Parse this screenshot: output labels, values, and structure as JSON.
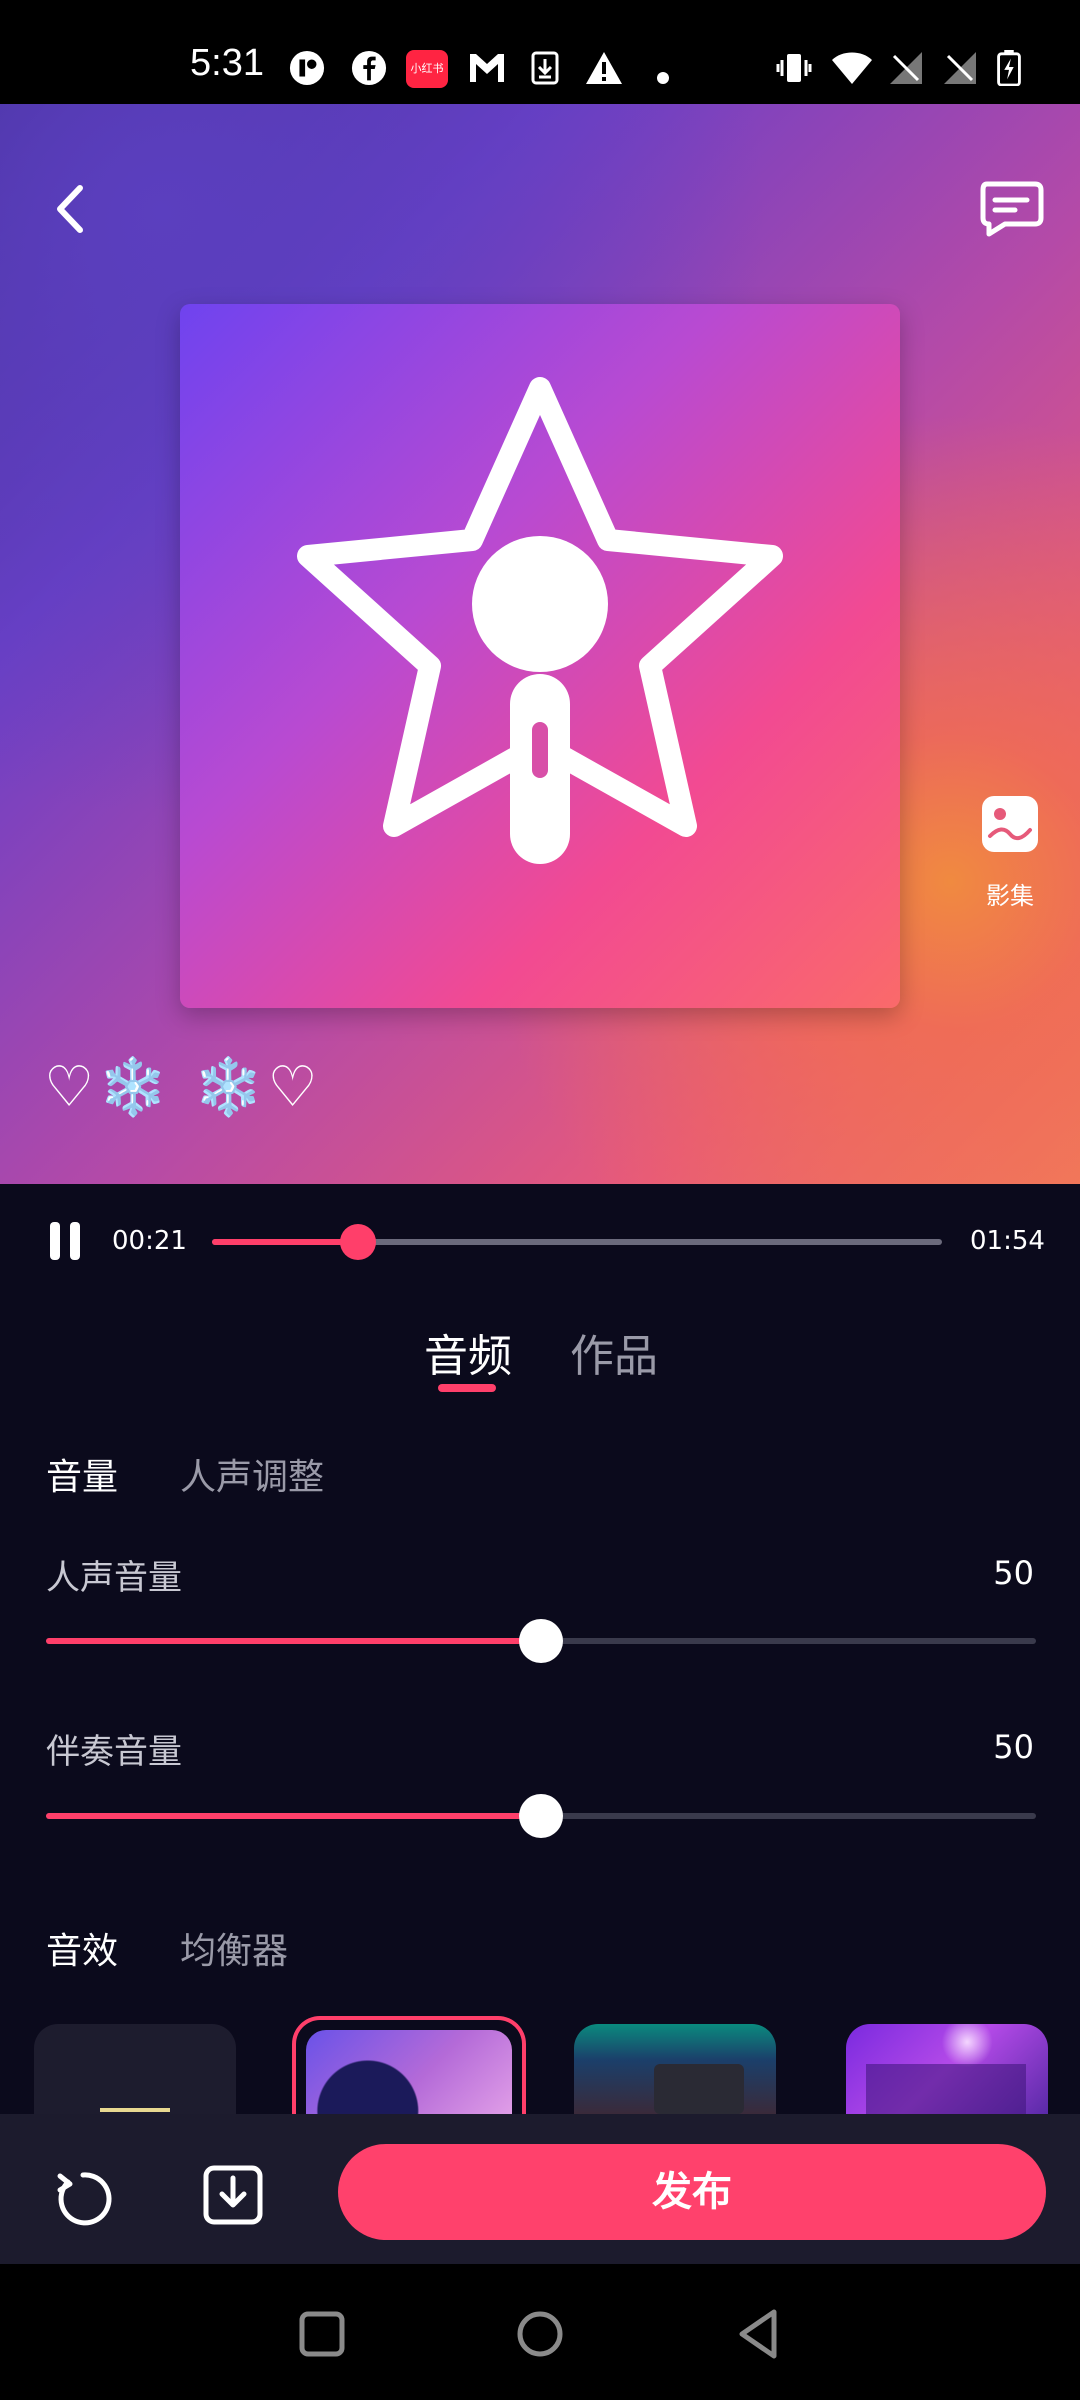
{
  "status_bar": {
    "time": "5:31",
    "icons": [
      "app-icon",
      "facebook-icon",
      "xiaohongshu-icon",
      "gmail-icon",
      "download-icon",
      "alert-icon",
      "dot-icon",
      "vibrate-icon",
      "wifi-icon",
      "no-signal-icon",
      "no-signal-icon",
      "battery-charging-icon"
    ],
    "badge_text": "小红书"
  },
  "hero": {
    "gallery_label": "影集",
    "emoji_line": "♡❄️ ❄️♡",
    "colors": {
      "accent": "#ff3f6a",
      "bg_dark": "#0b0a1c"
    }
  },
  "player": {
    "current_time": "00:21",
    "total_time": "01:54",
    "progress": 0.2
  },
  "tabs": {
    "items": [
      {
        "label": "音频",
        "active": true
      },
      {
        "label": "作品",
        "active": false
      }
    ]
  },
  "volume_section": {
    "tabs": [
      {
        "label": "音量",
        "active": true
      },
      {
        "label": "人声调整",
        "active": false
      }
    ],
    "sliders": [
      {
        "label": "人声音量",
        "value": "50",
        "fraction": 0.5
      },
      {
        "label": "伴奏音量",
        "value": "50",
        "fraction": 0.5
      }
    ]
  },
  "effects_section": {
    "tabs": [
      {
        "label": "音效",
        "active": true
      },
      {
        "label": "均衡器",
        "active": false
      }
    ],
    "selected_index": 1
  },
  "action_bar": {
    "publish_label": "发布"
  }
}
